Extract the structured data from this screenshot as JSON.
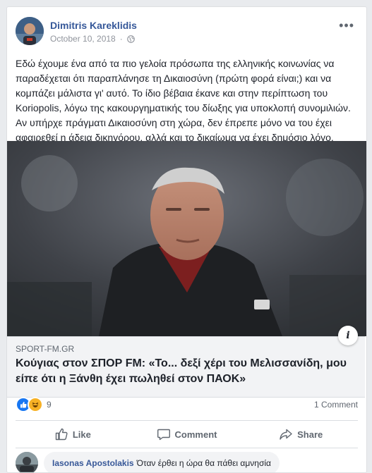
{
  "post": {
    "author": "Dimitris Kareklidis",
    "date": "October 10, 2018",
    "dot": "·",
    "text": "Εδώ έχουμε ένα από τα πιο γελοία πρόσωπα της ελληνικής κοινωνίας να παραδέχεται ότι παραπλάνησε τη Δικαιοσύνη (πρώτη φορά είναι;) και να κομπάζει μάλιστα γι' αυτό. Το ίδιο βέβαια έκανε και στην περίπτωση του Koriopolis, λόγω της κακουργηματικής του δίωξης για υποκλοπή συνομιλιών. Αν υπήρχε πράγματι Δικαιοσύνη στη χώρα, δεν έπρεπε μόνο να του έχει αφαιρεθεί η άδεια δικηγόρου, αλλά και το δικαίωμα να έχει δημόσιο λόγο.",
    "more_icon": "more-options-icon"
  },
  "link": {
    "domain": "SPORT-FM.GR",
    "title": "Κούγιας στον ΣΠΟΡ FM: «Το... δεξί χέρι του Μελισσανίδη, μου είπε ότι η Ξάνθη έχει πωληθεί στον ΠΑΟΚ»",
    "info_icon": "i"
  },
  "stats": {
    "reaction_count": "9",
    "comments": "1 Comment"
  },
  "actions": {
    "like": "Like",
    "comment": "Comment",
    "share": "Share"
  },
  "comment": {
    "name": "Iasonas Apostolakis",
    "text": "Όταν έρθει η ώρα θα πάθει αμνησία"
  },
  "colors": {
    "brand_link": "#365899",
    "like_blue": "#1877f2",
    "haha_yellow": "#f7b125",
    "muted": "#606770"
  }
}
